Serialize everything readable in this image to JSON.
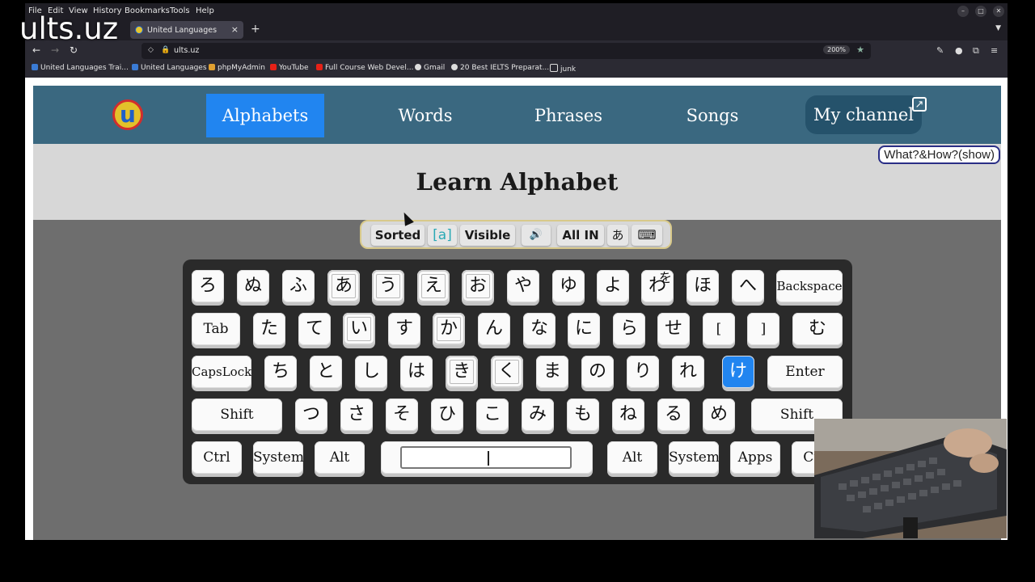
{
  "menubar": {
    "items": [
      "File",
      "Edit",
      "View",
      "History",
      "Bookmarks",
      "Tools",
      "Help"
    ]
  },
  "tab": {
    "title": "United Languages",
    "close": "×",
    "new_tab": "+"
  },
  "toolbar": {
    "url": "ults.uz",
    "zoom": "200%"
  },
  "bookmarks": [
    {
      "label": "United Languages Trai...",
      "color": "#3a7bd5"
    },
    {
      "label": "United Languages",
      "color": "#3a7bd5"
    },
    {
      "label": "phpMyAdmin",
      "color": "#e0a030"
    },
    {
      "label": "YouTube",
      "color": "#e62117"
    },
    {
      "label": "Full Course Web Devel...",
      "color": "#e62117"
    },
    {
      "label": "Gmail",
      "color": "#dddddd"
    },
    {
      "label": "20 Best IELTS Preparat...",
      "color": "#dddddd"
    },
    {
      "label": "junk",
      "color": "#dddddd"
    }
  ],
  "nav": {
    "logo_letter": "u",
    "items": [
      "Alphabets",
      "Words",
      "Phrases",
      "Songs",
      "My channel"
    ],
    "active": "Alphabets",
    "external_icon": "external-link-icon"
  },
  "header": {
    "title": "Learn Alphabet",
    "help_button": "What?&How?(show)"
  },
  "controls": {
    "sorted": "Sorted",
    "bracket": "[a]",
    "visible": "Visible",
    "sound": "🔊",
    "all_in": "All IN",
    "script": "あ",
    "keyboard": "⌨"
  },
  "keyboard": {
    "row1": [
      "ろ",
      "ぬ",
      "ふ",
      "あ",
      "う",
      "え",
      "お",
      "や",
      "ゆ",
      "よ",
      "わ",
      "ほ",
      "へ",
      "Backspace"
    ],
    "row1_extra": "を",
    "row2": [
      "Tab",
      "た",
      "て",
      "い",
      "す",
      "か",
      "ん",
      "な",
      "に",
      "ら",
      "せ",
      "[",
      "]",
      "む"
    ],
    "row3": [
      "CapsLock",
      "ち",
      "と",
      "し",
      "は",
      "き",
      "く",
      "ま",
      "の",
      "り",
      "れ",
      "け",
      "Enter"
    ],
    "row4": [
      "Shift",
      "つ",
      "さ",
      "そ",
      "ひ",
      "こ",
      "み",
      "も",
      "ね",
      "る",
      "め",
      "Shift"
    ],
    "row5": [
      "Ctrl",
      "System",
      "Alt",
      "",
      "Alt",
      "System",
      "Apps",
      "Ctrl"
    ]
  },
  "watermark": "ults.uz",
  "colors": {
    "nav_bg": "#3a6880",
    "active_blue": "#2185f0",
    "logo_yellow": "#e3c12a",
    "logo_red": "#d22d2d"
  }
}
